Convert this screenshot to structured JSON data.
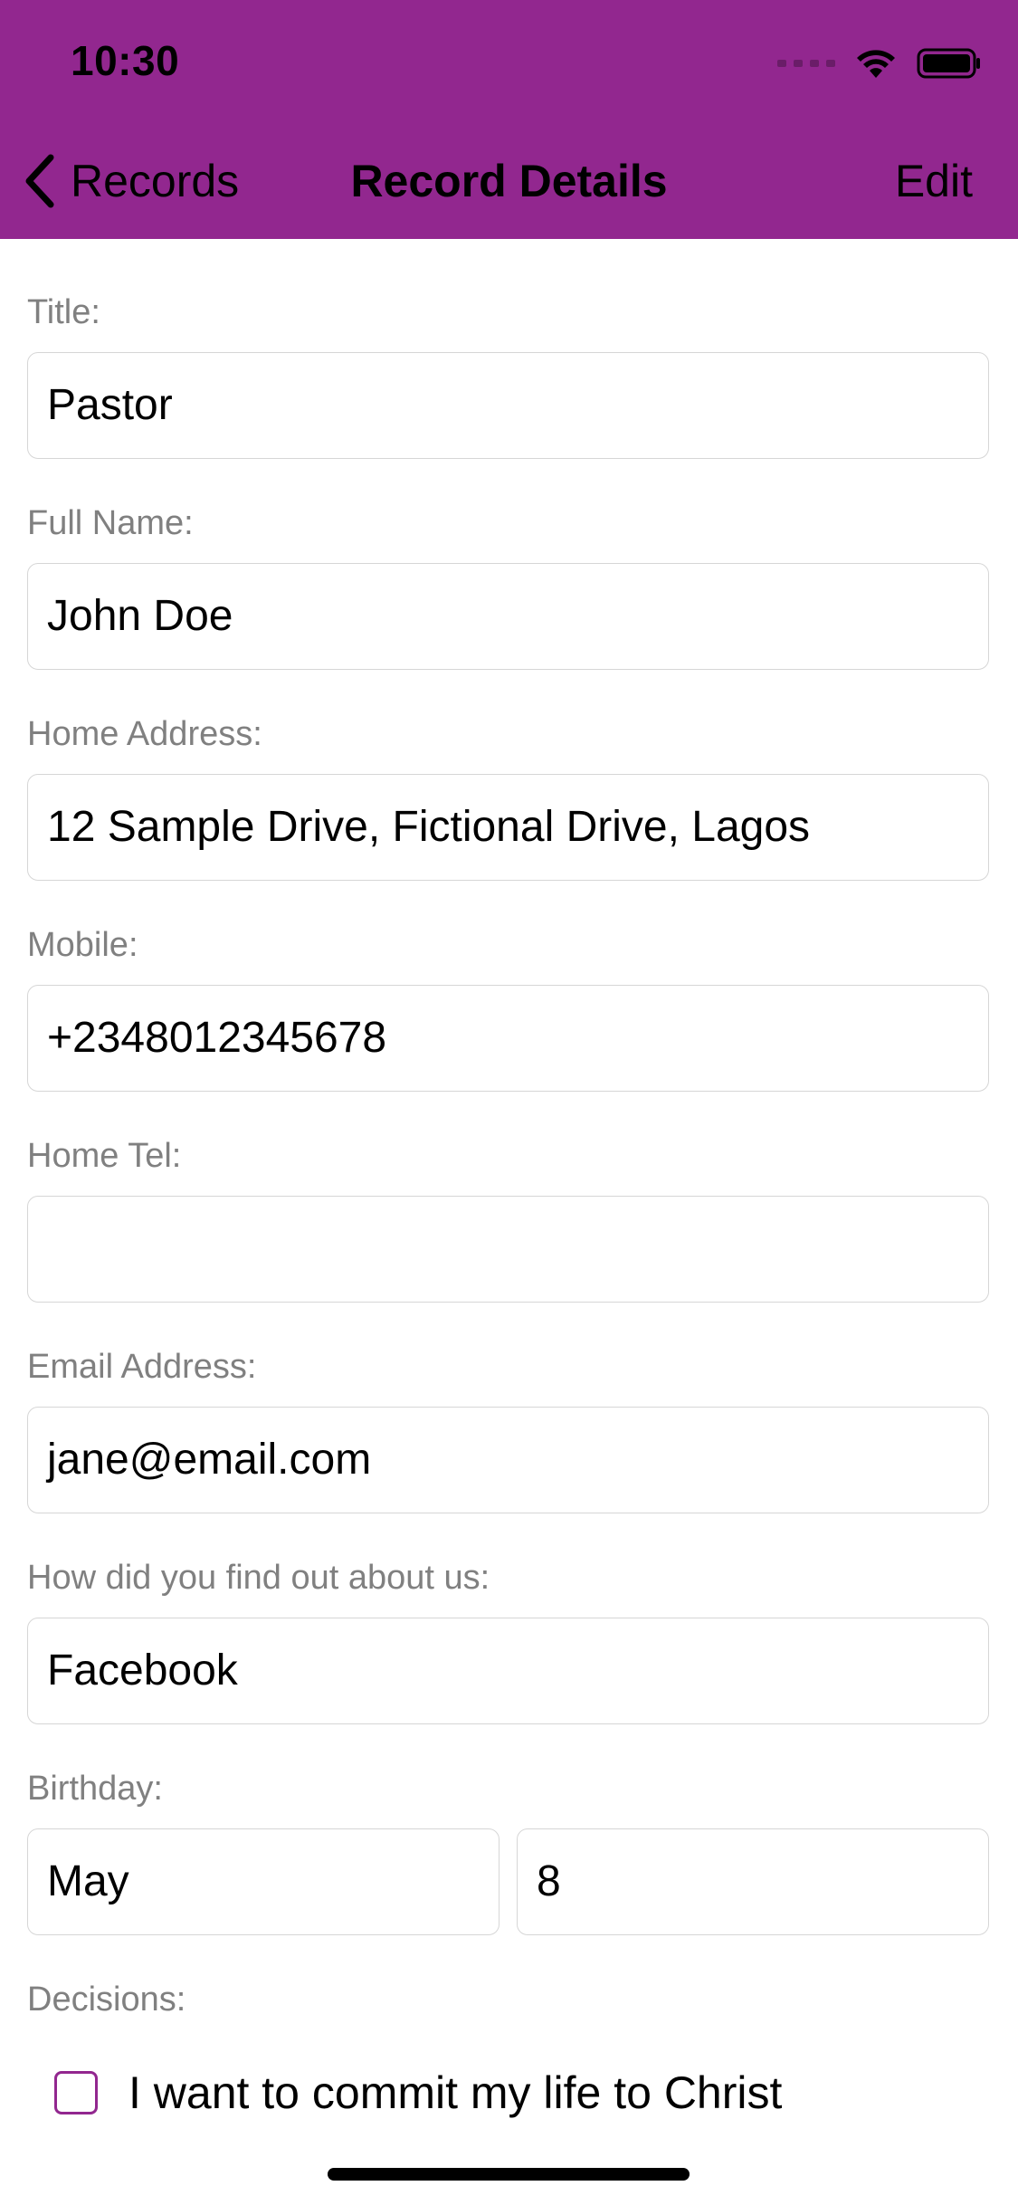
{
  "status_bar": {
    "time": "10:30"
  },
  "nav": {
    "back_label": "Records",
    "title": "Record Details",
    "edit_label": "Edit"
  },
  "form": {
    "title": {
      "label": "Title:",
      "value": "Pastor"
    },
    "full_name": {
      "label": "Full Name:",
      "value": "John Doe"
    },
    "home_address": {
      "label": "Home Address:",
      "value": "12 Sample Drive, Fictional Drive, Lagos"
    },
    "mobile": {
      "label": "Mobile:",
      "value": "+2348012345678"
    },
    "home_tel": {
      "label": "Home Tel:",
      "value": ""
    },
    "email": {
      "label": "Email Address:",
      "value": "jane@email.com"
    },
    "referral": {
      "label": "How did you find out about us:",
      "value": "Facebook"
    },
    "birthday": {
      "label": "Birthday:",
      "month": "May",
      "day": "8"
    },
    "decisions": {
      "label": "Decisions:",
      "options": [
        {
          "label": "I want to commit my life to Christ",
          "checked": false
        }
      ]
    }
  },
  "colors": {
    "accent": "#92278f",
    "label_gray": "#808080",
    "border_gray": "#d6d6d6"
  },
  "icons": {
    "back": "chevron-left-icon",
    "wifi": "wifi-icon",
    "battery": "battery-icon",
    "cellular": "cellular-signal-icon"
  }
}
